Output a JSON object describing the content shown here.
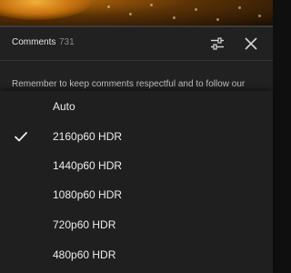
{
  "player": {
    "progress_fraction": 0.0
  },
  "comments": {
    "title": "Comments",
    "count": "731",
    "notice": "Remember to keep comments respectful and to follow our Community Guidelines"
  },
  "quality_menu": {
    "selected": "2160p60 HDR",
    "options": [
      {
        "label": "Auto"
      },
      {
        "label": "2160p60 HDR"
      },
      {
        "label": "1440p60 HDR"
      },
      {
        "label": "1080p60 HDR"
      },
      {
        "label": "720p60 HDR"
      },
      {
        "label": "480p60 HDR"
      }
    ]
  },
  "icons": {
    "filter": "sliders-icon",
    "close": "close-icon",
    "check": "check-icon"
  },
  "colors": {
    "progress": "#ff0000",
    "sheet_background": "#1f1f1f",
    "panel_background": "#212121"
  }
}
